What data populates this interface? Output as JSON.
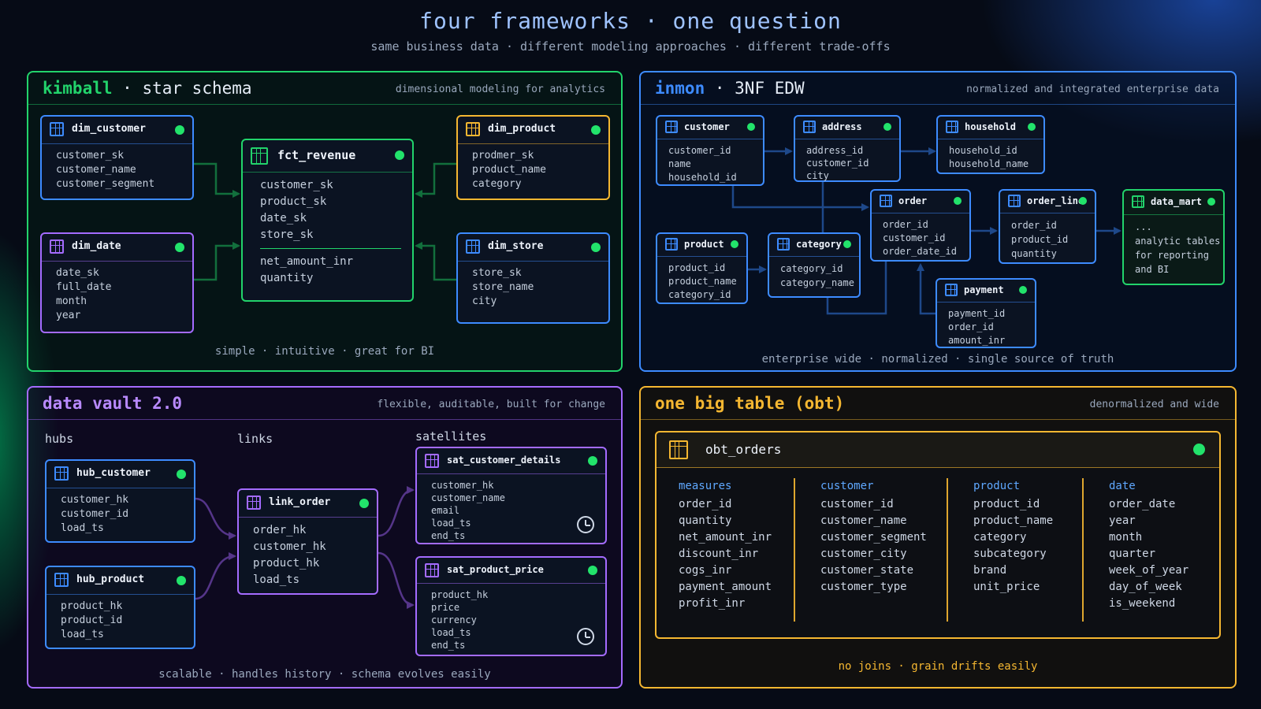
{
  "header": {
    "title": "four frameworks · one question",
    "subtitle": "same business data · different modeling approaches · different trade-offs"
  },
  "kimball": {
    "title_main": "kimball",
    "title_rest": "· star schema",
    "tagline": "dimensional modeling for analytics",
    "footer": "simple · intuitive · great for BI",
    "dim_customer": {
      "name": "dim_customer",
      "fields": [
        "customer_sk",
        "customer_name",
        "customer_segment"
      ]
    },
    "dim_date": {
      "name": "dim_date",
      "fields": [
        "date_sk",
        "full_date",
        "month",
        "year"
      ]
    },
    "fct_revenue": {
      "name": "fct_revenue",
      "keys": [
        "customer_sk",
        "product_sk",
        "date_sk",
        "store_sk"
      ],
      "measures": [
        "net_amount_inr",
        "quantity"
      ]
    },
    "dim_product": {
      "name": "dim_product",
      "fields": [
        "prodmer_sk",
        "product_name",
        "category"
      ]
    },
    "dim_store": {
      "name": "dim_store",
      "fields": [
        "store_sk",
        "store_name",
        "city"
      ]
    }
  },
  "inmon": {
    "title_main": "inmon",
    "title_rest": "· 3NF EDW",
    "tagline": "normalized and integrated enterprise data",
    "footer": "enterprise wide · normalized · single source of truth",
    "customer": {
      "name": "customer",
      "fields": [
        "customer_id",
        "name",
        "household_id"
      ]
    },
    "address": {
      "name": "address",
      "fields": [
        "address_id",
        "customer_id",
        "city"
      ]
    },
    "household": {
      "name": "household",
      "fields": [
        "household_id",
        "household_name"
      ]
    },
    "order": {
      "name": "order",
      "fields": [
        "order_id",
        "customer_id",
        "order_date_id"
      ]
    },
    "order_line": {
      "name": "order_line",
      "fields": [
        "order_id",
        "product_id",
        "quantity"
      ]
    },
    "data_mart": {
      "name": "data_mart",
      "fields": [
        "...",
        "analytic tables",
        "for reporting",
        "and BI"
      ]
    },
    "product": {
      "name": "product",
      "fields": [
        "product_id",
        "product_name",
        "category_id"
      ]
    },
    "category": {
      "name": "category",
      "fields": [
        "category_id",
        "category_name"
      ]
    },
    "payment": {
      "name": "payment",
      "fields": [
        "payment_id",
        "order_id",
        "amount_inr"
      ]
    }
  },
  "vault": {
    "title_main": "data vault 2.0",
    "tagline": "flexible, auditable, built for change",
    "footer": "scalable · handles history · schema evolves easily",
    "hubs_label": "hubs",
    "links_label": "links",
    "satellites_label": "satellites",
    "hub_customer": {
      "name": "hub_customer",
      "fields": [
        "customer_hk",
        "customer_id",
        "load_ts"
      ]
    },
    "hub_product": {
      "name": "hub_product",
      "fields": [
        "product_hk",
        "product_id",
        "load_ts"
      ]
    },
    "link_order": {
      "name": "link_order",
      "fields": [
        "order_hk",
        "customer_hk",
        "product_hk",
        "load_ts"
      ]
    },
    "sat_customer_details": {
      "name": "sat_customer_details",
      "fields": [
        "customer_hk",
        "customer_name",
        "email",
        "load_ts",
        "end_ts"
      ]
    },
    "sat_product_price": {
      "name": "sat_product_price",
      "fields": [
        "product_hk",
        "price",
        "currency",
        "load_ts",
        "end_ts"
      ]
    }
  },
  "obt": {
    "title_main": "one big table (obt)",
    "tagline": "denormalized and wide",
    "footer": "no joins · grain drifts easily",
    "table_name": "obt_orders",
    "columns": [
      {
        "header": "measures",
        "fields": [
          "order_id",
          "quantity",
          "net_amount_inr",
          "discount_inr",
          "cogs_inr",
          "payment_amount",
          "profit_inr"
        ]
      },
      {
        "header": "customer",
        "fields": [
          "customer_id",
          "customer_name",
          "customer_segment",
          "customer_city",
          "customer_state",
          "customer_type"
        ]
      },
      {
        "header": "product",
        "fields": [
          "product_id",
          "product_name",
          "category",
          "subcategory",
          "brand",
          "unit_price"
        ]
      },
      {
        "header": "date",
        "fields": [
          "order_date",
          "year",
          "month",
          "quarter",
          "week_of_year",
          "day_of_week",
          "is_weekend"
        ]
      }
    ]
  },
  "colors": {
    "kimball": "#22d36b",
    "inmon": "#3d8bff",
    "vault": "#a46bff",
    "obt": "#f5b731",
    "fact_green": "#22d36b",
    "dim_blue": "#3d8bff",
    "dim_purple": "#a46bff",
    "dim_orange": "#f5b731",
    "status_dot": "#22e36b"
  }
}
